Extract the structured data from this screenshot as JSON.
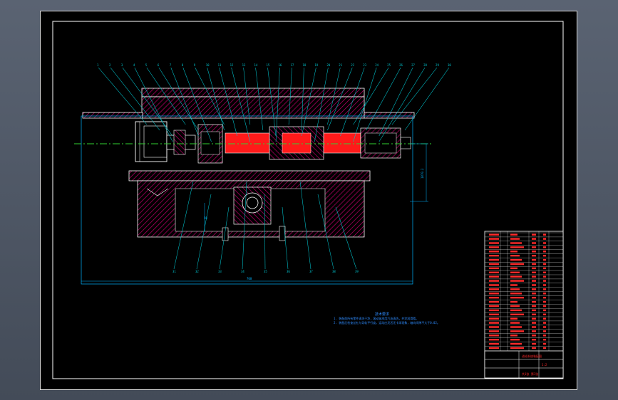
{
  "colors": {
    "viewport_bg": "#4a5361",
    "sheet_bg": "#000000",
    "frame": "#ffffff",
    "part_outline": "#ffffff",
    "section_hatch": "#c8006e",
    "screw_highlight": "#ff1a1a",
    "leader": "#00c8d2",
    "centerline": "#32d232",
    "dimension": "#00b4ff",
    "note_text": "#2f8cff",
    "title_block_text": "#ff2a2a",
    "title_block_lines": "#ffffff"
  },
  "balloons": {
    "top": [
      "1",
      "2",
      "3",
      "4",
      "5",
      "6",
      "7",
      "8",
      "9",
      "10",
      "11",
      "12",
      "13",
      "14",
      "15",
      "16",
      "17",
      "18",
      "19",
      "20",
      "21",
      "22",
      "23",
      "24",
      "25",
      "26",
      "27",
      "28",
      "29",
      "30"
    ],
    "bottom": [
      "31",
      "32",
      "33",
      "34",
      "35",
      "36",
      "37",
      "38",
      "39"
    ]
  },
  "dimensions": {
    "width_label": "700",
    "height_label": "1870.2",
    "small_label": "50"
  },
  "notes": {
    "heading": "技术要求",
    "line1": "1. 装配前所有零件清洗干净，滚动轴承用汽油清洗，并涂润滑脂。",
    "line2": "2. 装配后检查丝杠与导轨平行度，运动应灵活无卡滞现象，轴向间隙不大于0.02。"
  },
  "title_block": {
    "drawing_name": "进给系统装配图",
    "scale": "1:2",
    "sheet": "共1张 第1张"
  }
}
